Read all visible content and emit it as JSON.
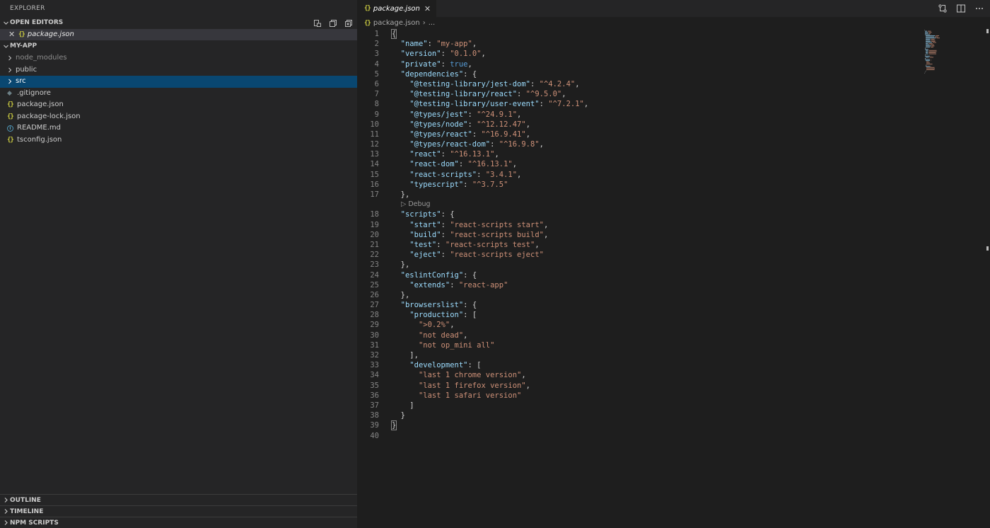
{
  "sidebar": {
    "title": "EXPLORER",
    "open_editors": {
      "header": "OPEN EDITORS",
      "items": [
        {
          "name": "package.json"
        }
      ]
    },
    "project": {
      "header": "MY-APP",
      "items": [
        {
          "name": "node_modules",
          "type": "folder"
        },
        {
          "name": "public",
          "type": "folder"
        },
        {
          "name": "src",
          "type": "folder"
        },
        {
          "name": ".gitignore",
          "type": "git"
        },
        {
          "name": "package.json",
          "type": "json"
        },
        {
          "name": "package-lock.json",
          "type": "json"
        },
        {
          "name": "README.md",
          "type": "info"
        },
        {
          "name": "tsconfig.json",
          "type": "json"
        }
      ]
    },
    "bottom_sections": [
      "OUTLINE",
      "TIMELINE",
      "NPM SCRIPTS"
    ]
  },
  "editor": {
    "tab": {
      "name": "package.json"
    },
    "breadcrumb": {
      "file": "package.json",
      "more": "..."
    },
    "codelens": "Debug",
    "code_lines": [
      "{",
      "  \"name\": \"my-app\",",
      "  \"version\": \"0.1.0\",",
      "  \"private\": true,",
      "  \"dependencies\": {",
      "    \"@testing-library/jest-dom\": \"^4.2.4\",",
      "    \"@testing-library/react\": \"^9.5.0\",",
      "    \"@testing-library/user-event\": \"^7.2.1\",",
      "    \"@types/jest\": \"^24.9.1\",",
      "    \"@types/node\": \"^12.12.47\",",
      "    \"@types/react\": \"^16.9.41\",",
      "    \"@types/react-dom\": \"^16.9.8\",",
      "    \"react\": \"^16.13.1\",",
      "    \"react-dom\": \"^16.13.1\",",
      "    \"react-scripts\": \"3.4.1\",",
      "    \"typescript\": \"^3.7.5\"",
      "  },",
      "  \"scripts\": {",
      "    \"start\": \"react-scripts start\",",
      "    \"build\": \"react-scripts build\",",
      "    \"test\": \"react-scripts test\",",
      "    \"eject\": \"react-scripts eject\"",
      "  },",
      "  \"eslintConfig\": {",
      "    \"extends\": \"react-app\"",
      "  },",
      "  \"browserslist\": {",
      "    \"production\": [",
      "      \">0.2%\",",
      "      \"not dead\",",
      "      \"not op_mini all\"",
      "    ],",
      "    \"development\": [",
      "      \"last 1 chrome version\",",
      "      \"last 1 firefox version\",",
      "      \"last 1 safari version\"",
      "    ]",
      "  }",
      "}",
      ""
    ]
  },
  "colors": {
    "key": "#9cdcfe",
    "string": "#ce9178",
    "boolean": "#569cd6",
    "json_icon": "#cbcb41",
    "selection": "#094771"
  }
}
